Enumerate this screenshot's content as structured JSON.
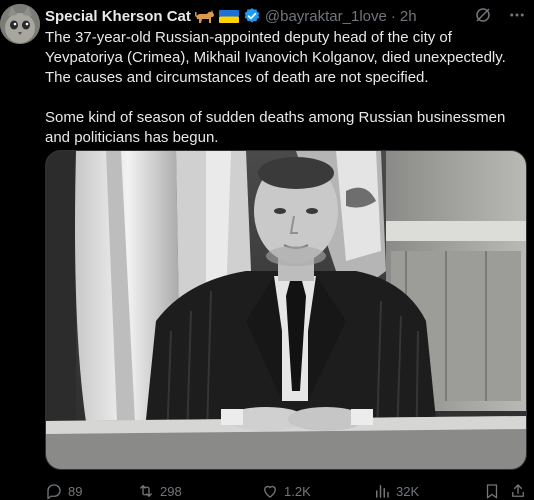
{
  "tweet": {
    "author_name": "Special Kherson Cat",
    "author_emojis": [
      "cat-emoji",
      "ukraine-flag-emoji"
    ],
    "verified": true,
    "handle": "@bayraktar_1love",
    "separator": "·",
    "time": "2h",
    "text_paragraph_1": "The 37-year-old Russian-appointed deputy head of the city of Yevpatoriya (Crimea), Mikhail Ivanovich Kolganov, died unexpectedly. The causes and circumstances of death are not specified.",
    "text_paragraph_2": "Some kind of season of sudden deaths among Russian businessmen and politicians has begun.",
    "media": "black-and-white photo of a man in a pinstripe suit seated at a desk in front of flags"
  },
  "actions": {
    "replies": "89",
    "reposts": "298",
    "likes": "1.2K",
    "views": "32K"
  },
  "icons": {
    "top": [
      "grok-icon",
      "more-icon"
    ],
    "actions": [
      "reply-icon",
      "repost-icon",
      "like-icon",
      "views-icon",
      "bookmark-icon",
      "share-icon"
    ]
  },
  "colors": {
    "background": "#000000",
    "text": "#e7e9ea",
    "secondary": "#71767b",
    "verified": "#1d9bf0"
  }
}
